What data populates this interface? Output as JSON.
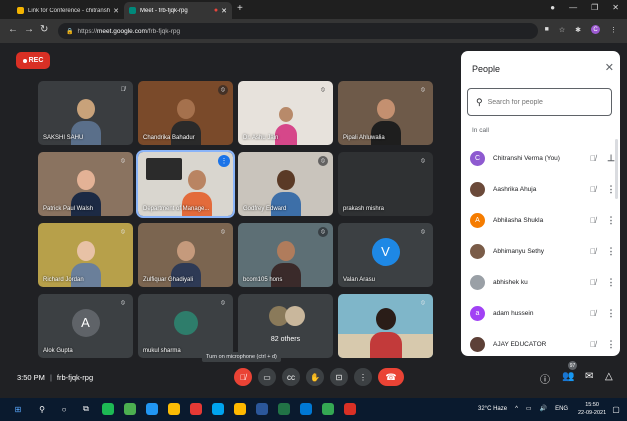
{
  "browser": {
    "tabs": [
      {
        "title": "Link for Conference - chitranshi",
        "active": false
      },
      {
        "title": "Meet - frb-fjqk-rpg",
        "active": true
      }
    ],
    "url": "https://meet.google.com/frb-fjqk-rpg",
    "url_prefix": "https://",
    "url_host": "meet.google.com",
    "url_path": "/frb-fjqk-rpg",
    "profile_initial": "C"
  },
  "recording": {
    "label": "REC"
  },
  "tiles": [
    {
      "name": "SAKSHI SAHU"
    },
    {
      "name": "Chandrika Bahadur"
    },
    {
      "name": "Dr. Ashu Jain"
    },
    {
      "name": "Pipali Ahluwalia"
    },
    {
      "name": "Patrick Paul Walsh"
    },
    {
      "name": "Department of Manage..."
    },
    {
      "name": "Godfrey Edward"
    },
    {
      "name": "prakash mishra"
    },
    {
      "name": "Richard Jordan"
    },
    {
      "name": "Zulfiquar Ghadiyali"
    },
    {
      "name": "bcom105 hons"
    },
    {
      "name": "Valan Arasu",
      "initial": "V"
    },
    {
      "name": "Alok Gupta",
      "initial": "A"
    },
    {
      "name": "mukul sharma"
    },
    {
      "others_label": "82 others"
    },
    {
      "name": ""
    }
  ],
  "people": {
    "title": "People",
    "search_placeholder": "Search for people",
    "section_label": "In call",
    "items": [
      {
        "name": "Chitranshi Verma (You)",
        "initial": "C"
      },
      {
        "name": "Aashrika Ahuja",
        "initial": ""
      },
      {
        "name": "Abhilasha Shukla",
        "initial": "A"
      },
      {
        "name": "Abhimanyu Sethy",
        "initial": ""
      },
      {
        "name": "abhishek ku",
        "initial": ""
      },
      {
        "name": "adam hussein",
        "initial": "a"
      },
      {
        "name": "AJAY EDUCATOR",
        "initial": ""
      }
    ]
  },
  "meeting": {
    "time": "3:50 PM",
    "code": "frb-fjqk-rpg",
    "tooltip": "Turn on microphone (ctrl + d)",
    "participant_count": "97"
  },
  "taskbar": {
    "weather": "32°C Haze",
    "language": "ENG",
    "time": "15:50",
    "date": "22-09-2021"
  }
}
